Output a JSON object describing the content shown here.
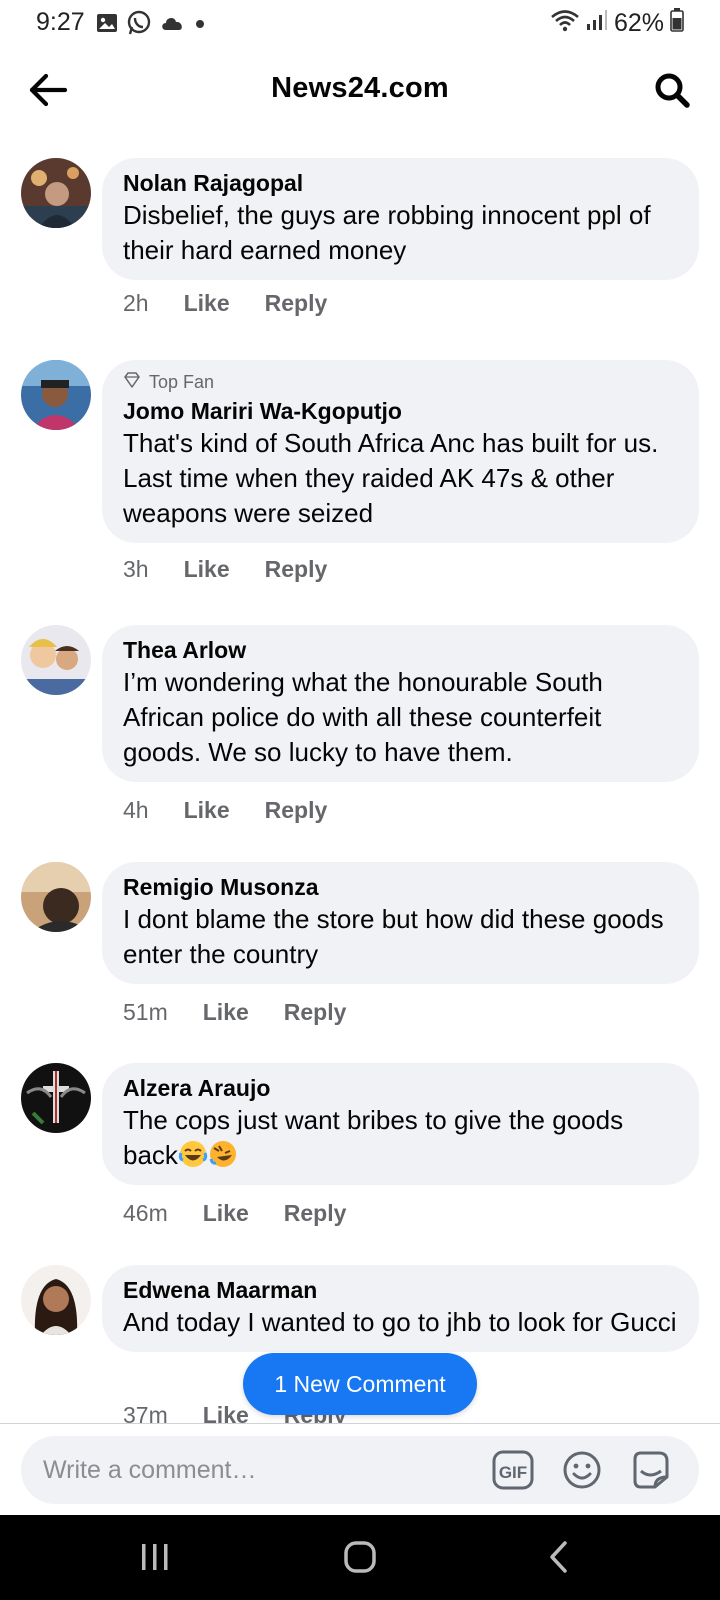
{
  "status_bar": {
    "time": "9:27",
    "battery": "62%",
    "icons": [
      "gallery-icon",
      "whatsapp-icon",
      "cloud-icon",
      "dot-icon",
      "wifi-icon",
      "signal-icon",
      "battery-icon"
    ]
  },
  "header": {
    "title": "News24.com",
    "back_icon": "arrow-left-icon",
    "search_icon": "search-icon"
  },
  "comments": [
    {
      "author": "Nolan Rajagopal",
      "text": "Disbelief, the guys are robbing innocent ppl of their hard earned money",
      "time": "2h",
      "like": "Like",
      "reply": "Reply",
      "top_fan": ""
    },
    {
      "author": "Jomo Mariri Wa-Kgoputjo",
      "text": "That's kind of South Africa Anc has built for us. Last time when they raided AK 47s & other weapons were seized",
      "time": "3h",
      "like": "Like",
      "reply": "Reply",
      "top_fan": "Top Fan"
    },
    {
      "author": "Thea Arlow",
      "text": "I’m wondering what the honourable  South African police do with all these counterfeit goods.  We so lucky to have them.",
      "time": "4h",
      "like": "Like",
      "reply": "Reply",
      "top_fan": ""
    },
    {
      "author": "Remigio Musonza",
      "text": "I dont blame the store but how did these goods enter the country",
      "time": "51m",
      "like": "Like",
      "reply": "Reply",
      "top_fan": ""
    },
    {
      "author": "Alzera Araujo",
      "text": "The cops just want bribes to give the goods back",
      "time": "46m",
      "like": "Like",
      "reply": "Reply",
      "top_fan": "",
      "emojis": [
        "tears-of-joy-emoji",
        "rolling-laughing-emoji"
      ]
    },
    {
      "author": "Edwena Maarman",
      "text": "And today I wanted to go to jhb to look for Gucci",
      "time": "37m",
      "like": "Like",
      "reply": "Reply",
      "top_fan": ""
    }
  ],
  "new_comment_pill": "1 New Comment",
  "composer": {
    "placeholder": "Write a comment…",
    "gif_label": "GIF",
    "icons": [
      "gif-icon",
      "emoji-icon",
      "sticker-icon"
    ]
  },
  "navigation": {
    "icons": [
      "recent-apps-icon",
      "home-icon",
      "back-icon"
    ]
  },
  "colors": {
    "accent": "#1877f2",
    "bubble": "#f0f2f5",
    "secondary_text": "#65676b",
    "nav_bar": "#000000"
  }
}
